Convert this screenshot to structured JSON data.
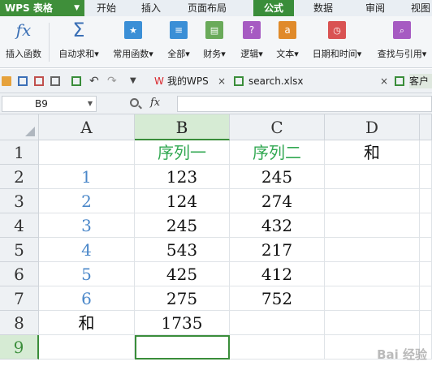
{
  "app": {
    "name": "WPS 表格"
  },
  "menu_tabs": [
    "开始",
    "插入",
    "页面布局",
    "公式",
    "数据",
    "审阅",
    "视图"
  ],
  "active_tab": "公式",
  "ribbon": {
    "insert_fn": "插入函数",
    "autosum": "自动求和",
    "common_fn": "常用函数",
    "all": "全部",
    "finance": "财务",
    "logic": "逻辑",
    "text": "文本",
    "datetime": "日期和时间",
    "lookup": "查找与引用",
    "fx_glyph": "fx",
    "sigma_glyph": "Σ",
    "caret": "▾"
  },
  "qat": {
    "doc_tabs": [
      "我的WPS",
      "search.xlsx",
      "客户"
    ],
    "close": "×"
  },
  "formula_bar": {
    "cell_ref": "B9",
    "fx": "fx"
  },
  "sheet": {
    "columns": [
      "A",
      "B",
      "C",
      "D"
    ],
    "rows": [
      "1",
      "2",
      "3",
      "4",
      "5",
      "6",
      "7",
      "8",
      "9"
    ],
    "cells": {
      "A2": "1",
      "A3": "2",
      "A4": "3",
      "A5": "4",
      "A6": "5",
      "A7": "6",
      "A8": "和",
      "B1": "序列一",
      "B2": "123",
      "B3": "124",
      "B4": "245",
      "B5": "543",
      "B6": "425",
      "B7": "275",
      "B8": "1735",
      "C1": "序列二",
      "C2": "245",
      "C3": "274",
      "C4": "432",
      "C5": "217",
      "C6": "412",
      "C7": "752",
      "D1": "和"
    },
    "selected_cell": "B9",
    "selected_column": "B",
    "selected_row": "9"
  },
  "watermark": "Bai 经验",
  "colors": {
    "accent": "#3a8d3a",
    "index_blue": "#4a87c9",
    "header_green": "#32a852"
  }
}
